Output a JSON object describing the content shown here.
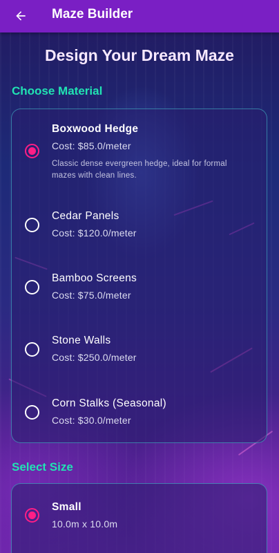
{
  "appbar": {
    "back_icon": "arrow-left-icon",
    "title": "Maze Builder",
    "color": "#7a1fc4"
  },
  "page": {
    "title": "Design Your Dream Maze"
  },
  "material_section": {
    "title": "Choose Material",
    "options": [
      {
        "name": "Boxwood Hedge",
        "cost": "Cost: $85.0/meter",
        "description": "Classic dense evergreen hedge, ideal for formal mazes with clean lines.",
        "selected": true
      },
      {
        "name": "Cedar Panels",
        "cost": "Cost: $120.0/meter",
        "selected": false
      },
      {
        "name": "Bamboo Screens",
        "cost": "Cost: $75.0/meter",
        "selected": false
      },
      {
        "name": "Stone Walls",
        "cost": "Cost: $250.0/meter",
        "selected": false
      },
      {
        "name": "Corn Stalks (Seasonal)",
        "cost": "Cost: $30.0/meter",
        "selected": false
      }
    ]
  },
  "size_section": {
    "title": "Select Size",
    "options": [
      {
        "name": "Small",
        "dimensions": "10.0m x 10.0m",
        "selected": true
      }
    ]
  },
  "colors": {
    "accent_teal": "#21e3b3",
    "radio_selected": "#ff1e86"
  }
}
